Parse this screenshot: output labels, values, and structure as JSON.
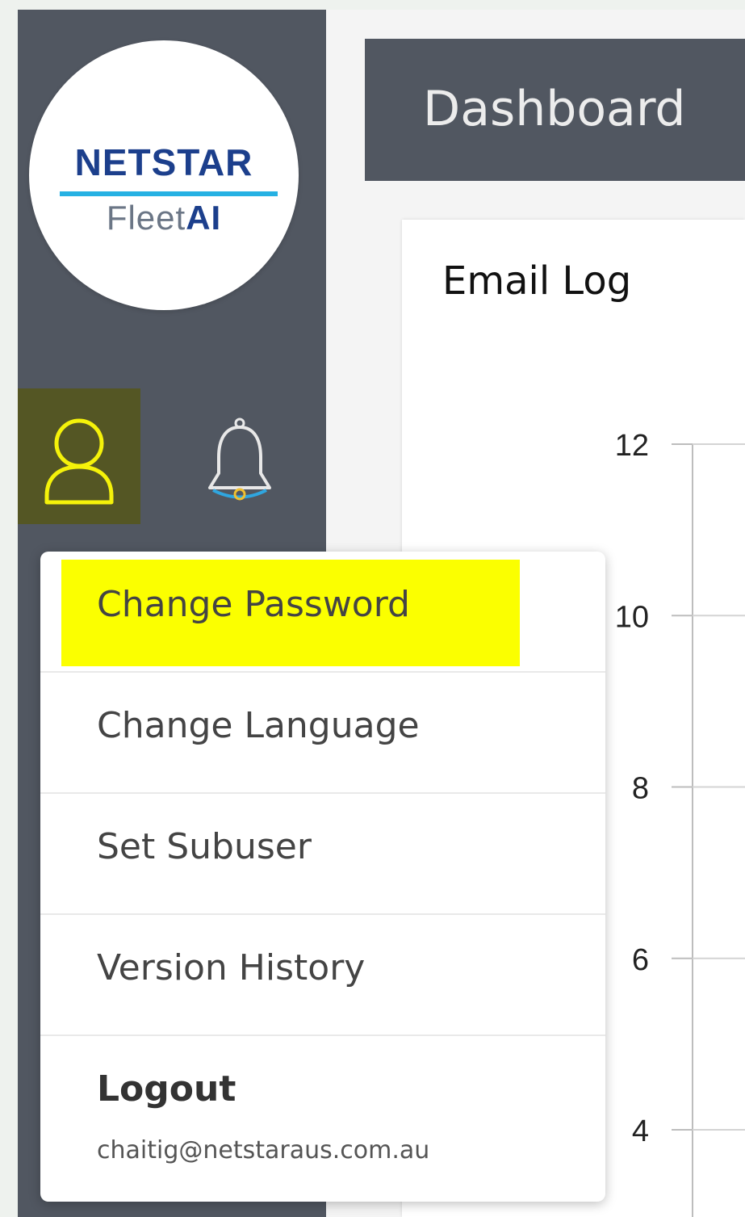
{
  "brand": {
    "name": "NETSTAR",
    "product_prefix": "Fleet",
    "product_suffix": "AI",
    "colors": {
      "navy": "#1c3f8c",
      "cyan": "#26b1e3",
      "grey": "#6b7686"
    }
  },
  "sidebar": {
    "icons": [
      {
        "name": "user-icon",
        "active": true,
        "color": "#f5f20a"
      },
      {
        "name": "bell-icon",
        "active": false
      }
    ]
  },
  "header": {
    "title": "Dashboard"
  },
  "card": {
    "title": "Email Log"
  },
  "chart_data": {
    "type": "line",
    "title": "Email Log",
    "y_ticks": [
      "12",
      "10",
      "8",
      "6",
      "4"
    ],
    "ylim": [
      4,
      12
    ],
    "grid": true
  },
  "user_menu": {
    "items": [
      {
        "label": "Change Password",
        "highlighted": true
      },
      {
        "label": "Change Language",
        "highlighted": false
      },
      {
        "label": "Set Subuser",
        "highlighted": false
      },
      {
        "label": "Version History",
        "highlighted": false
      }
    ],
    "logout": {
      "label": "Logout",
      "email": "chaitig@netstaraus.com.au"
    }
  },
  "theme": {
    "sidebar_bg": "#515761",
    "highlight": "#fbff00",
    "active_icon_bg": "#545624"
  }
}
